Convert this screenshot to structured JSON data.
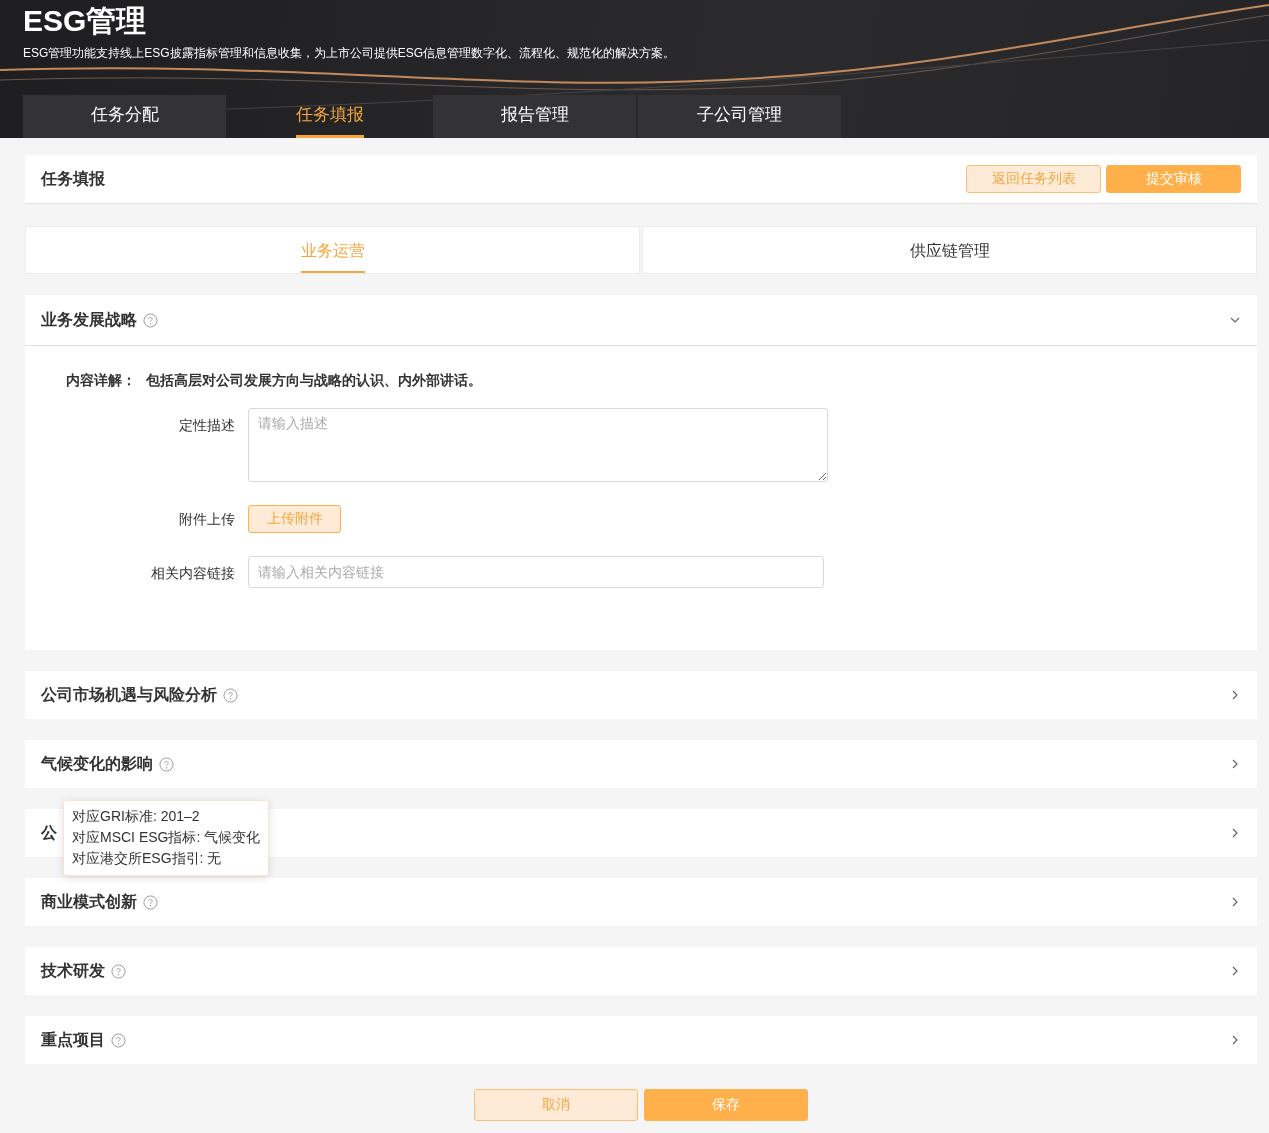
{
  "header": {
    "title": "ESG管理",
    "subtitle": "ESG管理功能支持线上ESG披露指标管理和信息收集，为上市公司提供ESG信息管理数字化、流程化、规范化的解决方案。"
  },
  "main_tabs": [
    {
      "label": "任务分配",
      "selected": false
    },
    {
      "label": "任务填报",
      "selected": true
    },
    {
      "label": "报告管理",
      "selected": false
    },
    {
      "label": "子公司管理",
      "selected": false
    }
  ],
  "task": {
    "title": "任务填报",
    "buttons": [
      {
        "label": "返回任务列表",
        "kind": "secondary"
      },
      {
        "label": "提交审核",
        "kind": "primary"
      }
    ]
  },
  "sub_tabs": [
    {
      "label": "业务运营",
      "selected": true
    },
    {
      "label": "供应链管理",
      "selected": false
    }
  ],
  "sections": [
    {
      "title": "业务发展战略",
      "help": true,
      "expanded": true,
      "detail_label": "内容详解：",
      "detail": "包括高层对公司发展方向与战略的认识、内外部讲话。",
      "fields": [
        {
          "kind": "textarea",
          "label": "定性描述",
          "placeholder": "请输入描述"
        },
        {
          "kind": "upload",
          "label": "附件上传",
          "button": "上传附件"
        },
        {
          "kind": "input",
          "label": "相关内容链接",
          "placeholder": "请输入相关内容链接"
        }
      ]
    },
    {
      "title": "公司市场机遇与风险分析",
      "help": true,
      "expanded": false
    },
    {
      "title": "气候变化的影响",
      "help": true,
      "expanded": false,
      "tooltip": [
        "对应GRI标准: 201–2",
        "对应MSCI ESG指标: 气候变化",
        "对应港交所ESG指引: 无"
      ]
    },
    {
      "title": "公",
      "help": false,
      "expanded": false
    },
    {
      "title": "商业模式创新",
      "help": true,
      "expanded": false
    },
    {
      "title": "技术研发",
      "help": true,
      "expanded": false
    },
    {
      "title": "重点项目",
      "help": true,
      "expanded": false
    }
  ],
  "footer_buttons": [
    {
      "label": "取消",
      "kind": "secondary"
    },
    {
      "label": "保存",
      "kind": "primary"
    }
  ]
}
